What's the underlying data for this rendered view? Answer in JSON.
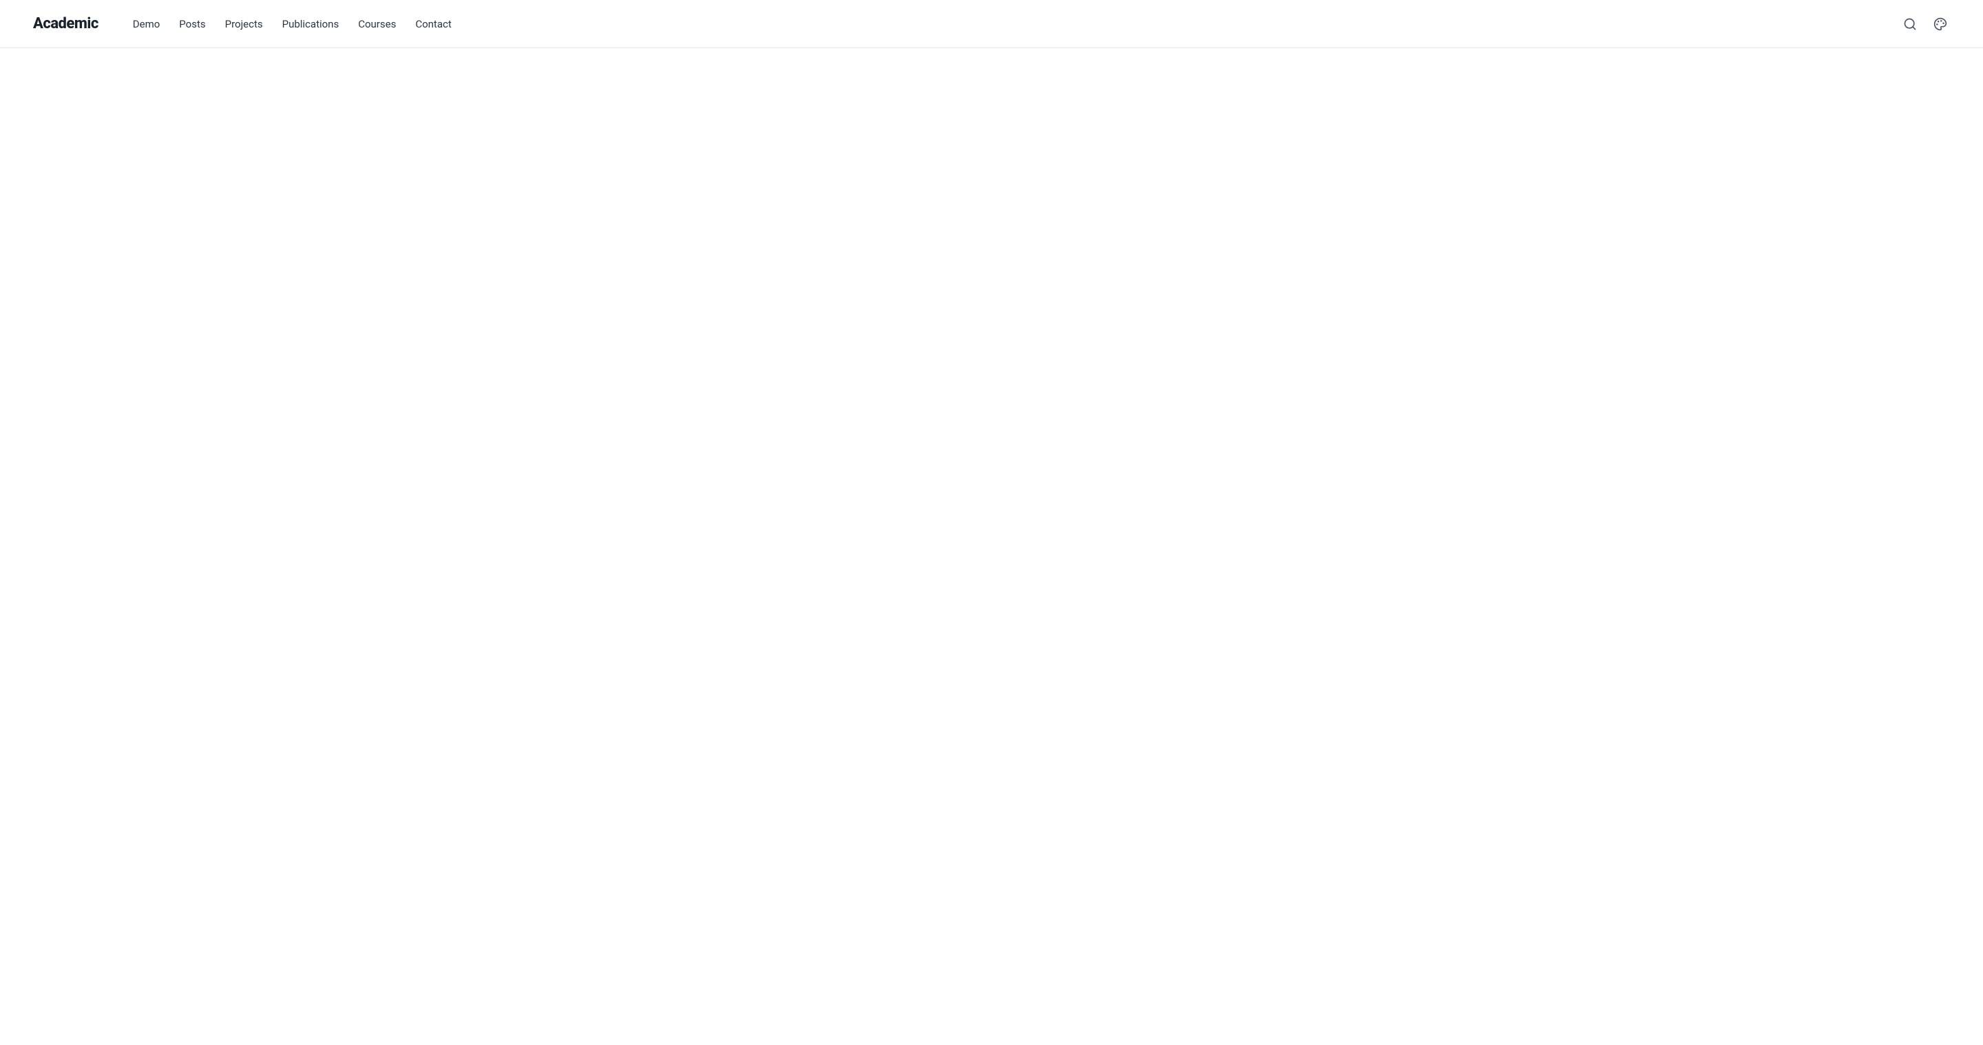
{
  "brand": {
    "name": "Academic"
  },
  "nav": {
    "items": [
      {
        "label": "Demo",
        "id": "demo"
      },
      {
        "label": "Posts",
        "id": "posts"
      },
      {
        "label": "Projects",
        "id": "projects"
      },
      {
        "label": "Publications",
        "id": "publications"
      },
      {
        "label": "Courses",
        "id": "courses"
      },
      {
        "label": "Contact",
        "id": "contact"
      }
    ]
  },
  "toolbar": {
    "search_aria": "Search",
    "theme_aria": "Change theme"
  }
}
